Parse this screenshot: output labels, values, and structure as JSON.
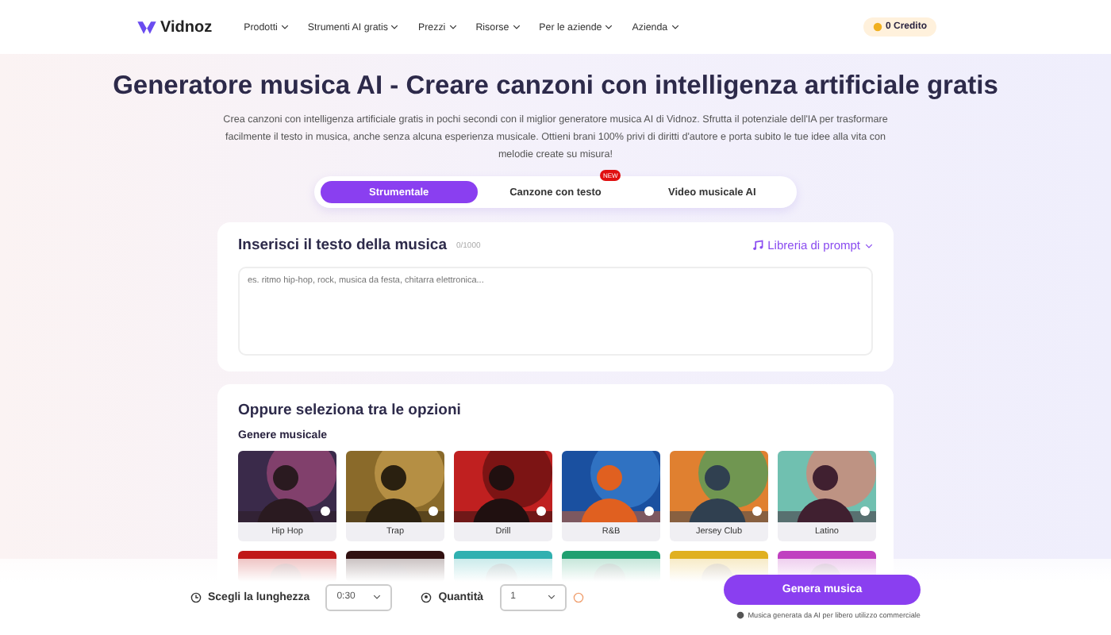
{
  "nav": {
    "logo": "Vidnoz",
    "items": [
      {
        "label": "Prodotti"
      },
      {
        "label": "Strumenti AI gratis"
      },
      {
        "label": "Prezzi"
      },
      {
        "label": "Risorse"
      },
      {
        "label": "Per le aziende"
      },
      {
        "label": "Azienda"
      }
    ],
    "credits": "0 Credito"
  },
  "title": "Generatore musica AI - Creare canzoni con intelligenza artificiale gratis",
  "subtitle": "Crea canzoni con intelligenza artificiale gratis in pochi secondi con il miglior generatore musica AI di Vidnoz. Sfrutta il potenziale dell'IA per trasformare facilmente il testo in musica, anche senza alcuna esperienza musicale. Ottieni brani 100% privi di diritti d'autore e porta subito le tue idee alla vita con melodie create su misura!",
  "tabs": [
    {
      "label": "Strumentale",
      "selected": true
    },
    {
      "label": "Canzone con testo",
      "selected": false,
      "badge": "NEW"
    },
    {
      "label": "Video musicale AI",
      "selected": false
    }
  ],
  "lyrics": {
    "heading": "Inserisci il testo della musica",
    "counter": "0/1000",
    "library": "Libreria di prompt",
    "placeholder": "es. ritmo hip-hop, rock, musica da festa, chitarra elettronica..."
  },
  "options": {
    "heading": "Oppure seleziona tra le opzioni",
    "genre_heading": "Genere musicale",
    "genres": [
      {
        "label": "Hip Hop",
        "selected": false,
        "kind": "picture"
      },
      {
        "label": "Trap",
        "selected": false,
        "kind": "picture"
      },
      {
        "label": "Drill",
        "selected": false,
        "kind": "picture"
      },
      {
        "label": "R&B",
        "selected": false,
        "kind": "picture"
      },
      {
        "label": "Jersey Club",
        "selected": false,
        "kind": "picture"
      },
      {
        "label": "Latino",
        "selected": false,
        "kind": "picture"
      }
    ]
  },
  "bottom_bar": {
    "length_label": "Scegli la lunghezza",
    "length_value": "0:30",
    "quantity_label": "Quantità",
    "quantity_value": "1",
    "generate": "Genera musica",
    "note": "Musica generata da AI per libero utilizzo commerciale"
  }
}
